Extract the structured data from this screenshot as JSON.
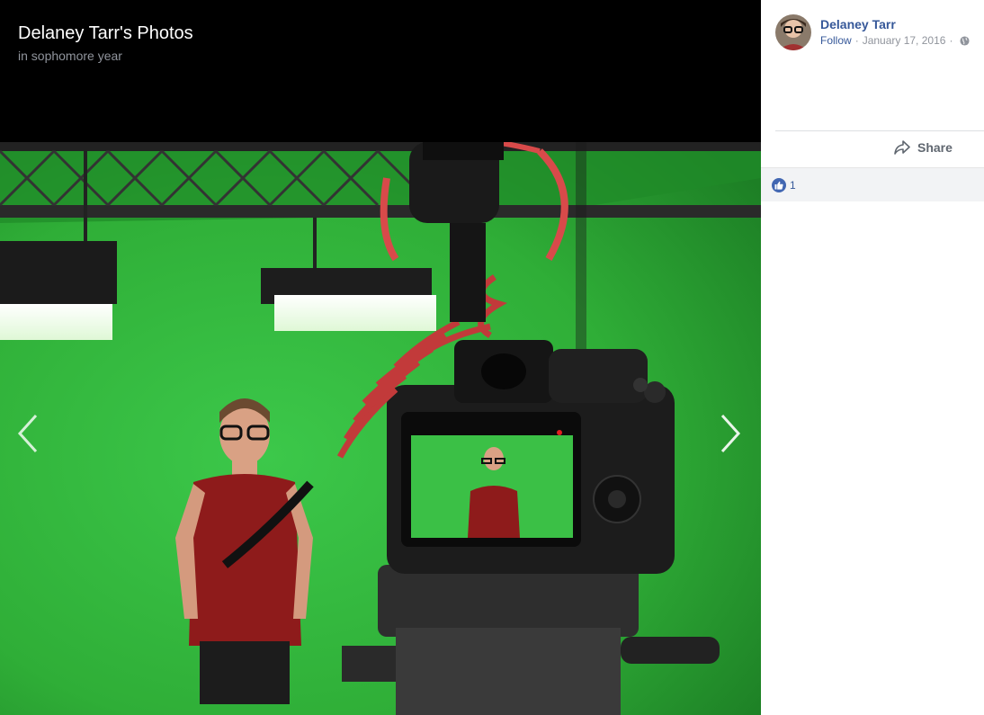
{
  "viewer": {
    "album_title": "Delaney Tarr's Photos",
    "album_subtitle": "in sophomore year",
    "prev_icon": "chevron-left-icon",
    "next_icon": "chevron-right-icon"
  },
  "post": {
    "author_name": "Delaney Tarr",
    "follow_label": "Follow",
    "separator": "·",
    "date": "January 17, 2016",
    "privacy_icon": "globe-icon",
    "share_label": "Share",
    "share_icon": "share-arrow-icon",
    "reaction_icon": "like-icon",
    "reaction_count": "1"
  },
  "colors": {
    "link": "#365899",
    "meta": "#90949c",
    "like": "#4267b2",
    "viewer_bg": "#000000",
    "green_screen": "#2fb83a"
  }
}
